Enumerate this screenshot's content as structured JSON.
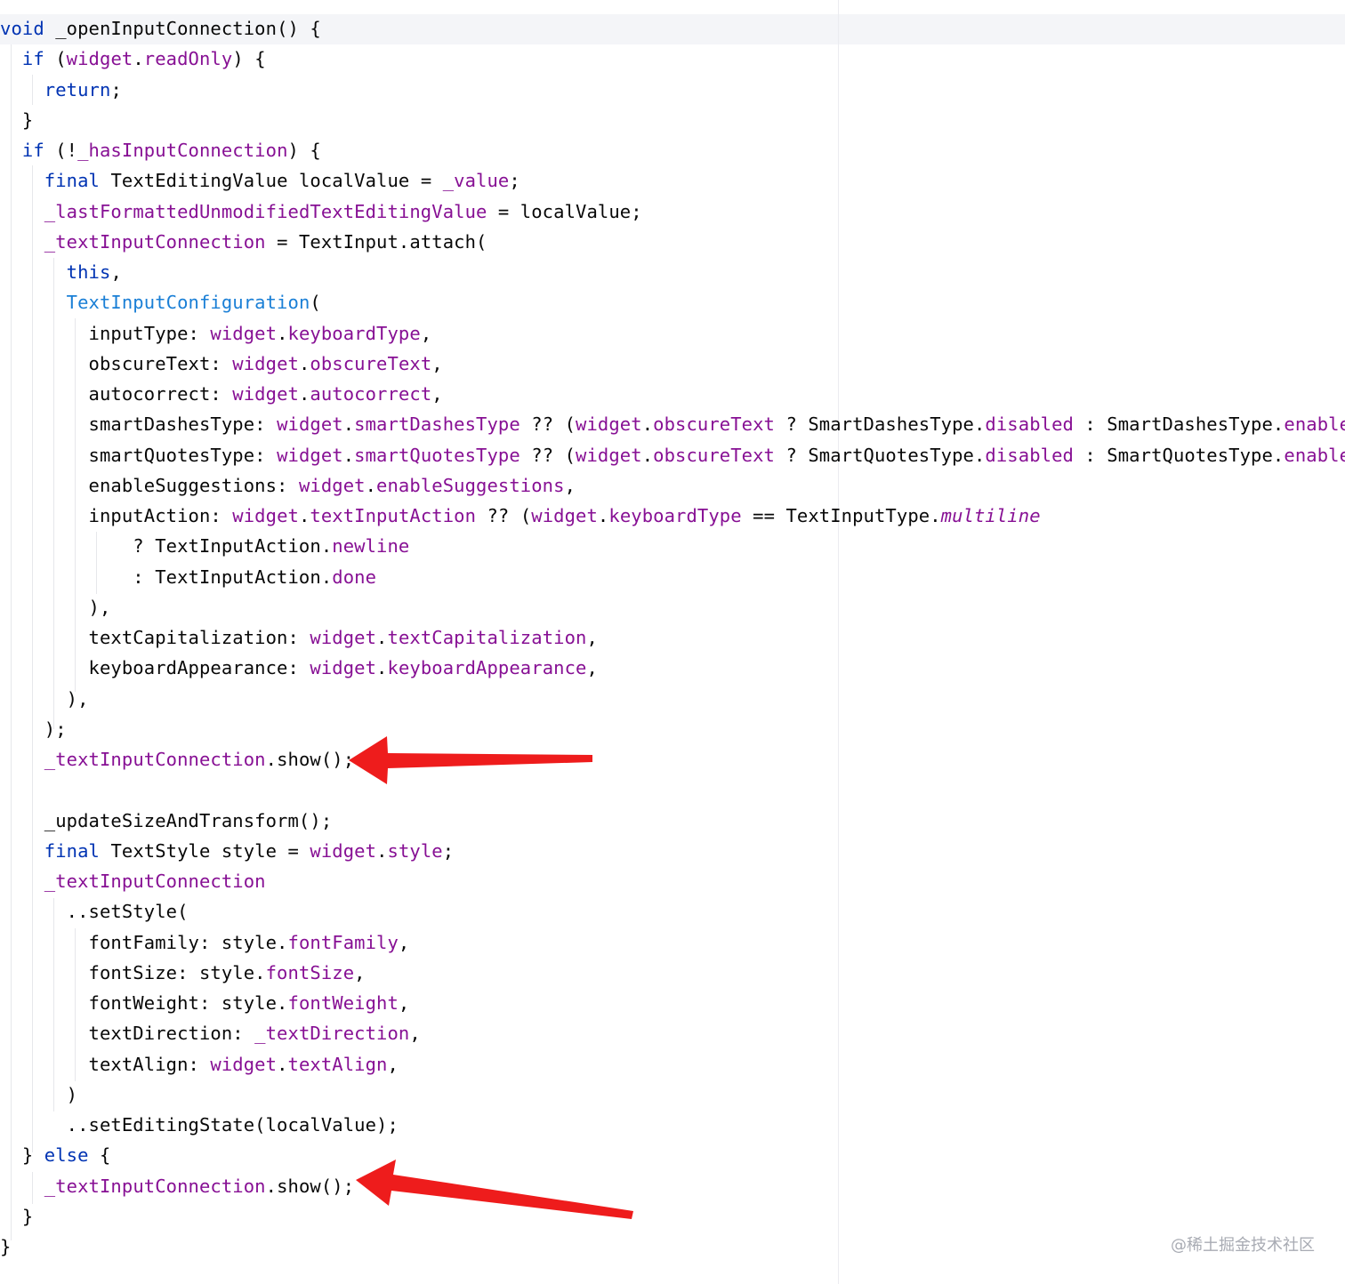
{
  "colors": {
    "keyword": "#0033b3",
    "field": "#871094",
    "function": "#00627a",
    "class": "#1a7fd6",
    "plain": "#080808",
    "arrow": "#ee1c1c",
    "current_line": "#f4f5f8"
  },
  "watermark": "@稀土掘金技术社区",
  "code_lines": [
    [
      {
        "t": "void",
        "c": "kw"
      },
      {
        "t": " _openInputConnection() {"
      }
    ],
    [
      {
        "t": "  "
      },
      {
        "t": "if",
        "c": "kw"
      },
      {
        "t": " ("
      },
      {
        "t": "widget",
        "c": "field"
      },
      {
        "t": "."
      },
      {
        "t": "readOnly",
        "c": "field"
      },
      {
        "t": ") {"
      }
    ],
    [
      {
        "t": "    "
      },
      {
        "t": "return",
        "c": "kw"
      },
      {
        "t": ";"
      }
    ],
    [
      {
        "t": "  }"
      }
    ],
    [
      {
        "t": "  "
      },
      {
        "t": "if",
        "c": "kw"
      },
      {
        "t": " (!"
      },
      {
        "t": "_hasInputConnection",
        "c": "field"
      },
      {
        "t": ") {"
      }
    ],
    [
      {
        "t": "    "
      },
      {
        "t": "final",
        "c": "kw"
      },
      {
        "t": " TextEditingValue localValue = "
      },
      {
        "t": "_value",
        "c": "field"
      },
      {
        "t": ";"
      }
    ],
    [
      {
        "t": "    "
      },
      {
        "t": "_lastFormattedUnmodifiedTextEditingValue",
        "c": "field"
      },
      {
        "t": " = localValue;"
      }
    ],
    [
      {
        "t": "    "
      },
      {
        "t": "_textInputConnection",
        "c": "field"
      },
      {
        "t": " = TextInput.attach("
      }
    ],
    [
      {
        "t": "      "
      },
      {
        "t": "this",
        "c": "kw"
      },
      {
        "t": ","
      }
    ],
    [
      {
        "t": "      "
      },
      {
        "t": "TextInputConfiguration",
        "c": "cls"
      },
      {
        "t": "("
      }
    ],
    [
      {
        "t": "        inputType: "
      },
      {
        "t": "widget",
        "c": "field"
      },
      {
        "t": "."
      },
      {
        "t": "keyboardType",
        "c": "field"
      },
      {
        "t": ","
      }
    ],
    [
      {
        "t": "        obscureText: "
      },
      {
        "t": "widget",
        "c": "field"
      },
      {
        "t": "."
      },
      {
        "t": "obscureText",
        "c": "field"
      },
      {
        "t": ","
      }
    ],
    [
      {
        "t": "        autocorrect: "
      },
      {
        "t": "widget",
        "c": "field"
      },
      {
        "t": "."
      },
      {
        "t": "autocorrect",
        "c": "field"
      },
      {
        "t": ","
      }
    ],
    [
      {
        "t": "        smartDashesType: "
      },
      {
        "t": "widget",
        "c": "field"
      },
      {
        "t": "."
      },
      {
        "t": "smartDashesType",
        "c": "field"
      },
      {
        "t": " ?? ("
      },
      {
        "t": "widget",
        "c": "field"
      },
      {
        "t": "."
      },
      {
        "t": "obscureText",
        "c": "field"
      },
      {
        "t": " ? SmartDashesType."
      },
      {
        "t": "disabled",
        "c": "field"
      },
      {
        "t": " : SmartDashesType."
      },
      {
        "t": "enabled",
        "c": "field"
      },
      {
        "t": "),"
      }
    ],
    [
      {
        "t": "        smartQuotesType: "
      },
      {
        "t": "widget",
        "c": "field"
      },
      {
        "t": "."
      },
      {
        "t": "smartQuotesType",
        "c": "field"
      },
      {
        "t": " ?? ("
      },
      {
        "t": "widget",
        "c": "field"
      },
      {
        "t": "."
      },
      {
        "t": "obscureText",
        "c": "field"
      },
      {
        "t": " ? SmartQuotesType."
      },
      {
        "t": "disabled",
        "c": "field"
      },
      {
        "t": " : SmartQuotesType."
      },
      {
        "t": "enabled",
        "c": "field"
      },
      {
        "t": "),"
      }
    ],
    [
      {
        "t": "        enableSuggestions: "
      },
      {
        "t": "widget",
        "c": "field"
      },
      {
        "t": "."
      },
      {
        "t": "enableSuggestions",
        "c": "field"
      },
      {
        "t": ","
      }
    ],
    [
      {
        "t": "        inputAction: "
      },
      {
        "t": "widget",
        "c": "field"
      },
      {
        "t": "."
      },
      {
        "t": "textInputAction",
        "c": "field"
      },
      {
        "t": " ?? ("
      },
      {
        "t": "widget",
        "c": "field"
      },
      {
        "t": "."
      },
      {
        "t": "keyboardType",
        "c": "field"
      },
      {
        "t": " == TextInputType."
      },
      {
        "t": "multiline",
        "c": "field-it"
      }
    ],
    [
      {
        "t": "            ? TextInputAction."
      },
      {
        "t": "newline",
        "c": "field"
      }
    ],
    [
      {
        "t": "            : TextInputAction."
      },
      {
        "t": "done",
        "c": "field"
      }
    ],
    [
      {
        "t": "        ),"
      }
    ],
    [
      {
        "t": "        textCapitalization: "
      },
      {
        "t": "widget",
        "c": "field"
      },
      {
        "t": "."
      },
      {
        "t": "textCapitalization",
        "c": "field"
      },
      {
        "t": ","
      }
    ],
    [
      {
        "t": "        keyboardAppearance: "
      },
      {
        "t": "widget",
        "c": "field"
      },
      {
        "t": "."
      },
      {
        "t": "keyboardAppearance",
        "c": "field"
      },
      {
        "t": ","
      }
    ],
    [
      {
        "t": "      ),"
      }
    ],
    [
      {
        "t": "    );"
      }
    ],
    [
      {
        "t": "    "
      },
      {
        "t": "_textInputConnection",
        "c": "field"
      },
      {
        "t": ".show();"
      }
    ],
    [
      {
        "t": ""
      }
    ],
    [
      {
        "t": "    _updateSizeAndTransform();"
      }
    ],
    [
      {
        "t": "    "
      },
      {
        "t": "final",
        "c": "kw"
      },
      {
        "t": " TextStyle style = "
      },
      {
        "t": "widget",
        "c": "field"
      },
      {
        "t": "."
      },
      {
        "t": "style",
        "c": "field"
      },
      {
        "t": ";"
      }
    ],
    [
      {
        "t": "    "
      },
      {
        "t": "_textInputConnection",
        "c": "field"
      }
    ],
    [
      {
        "t": "      ..setStyle("
      }
    ],
    [
      {
        "t": "        fontFamily: style."
      },
      {
        "t": "fontFamily",
        "c": "field"
      },
      {
        "t": ","
      }
    ],
    [
      {
        "t": "        fontSize: style."
      },
      {
        "t": "fontSize",
        "c": "field"
      },
      {
        "t": ","
      }
    ],
    [
      {
        "t": "        fontWeight: style."
      },
      {
        "t": "fontWeight",
        "c": "field"
      },
      {
        "t": ","
      }
    ],
    [
      {
        "t": "        textDirection: "
      },
      {
        "t": "_textDirection",
        "c": "field"
      },
      {
        "t": ","
      }
    ],
    [
      {
        "t": "        textAlign: "
      },
      {
        "t": "widget",
        "c": "field"
      },
      {
        "t": "."
      },
      {
        "t": "textAlign",
        "c": "field"
      },
      {
        "t": ","
      }
    ],
    [
      {
        "t": "      )"
      }
    ],
    [
      {
        "t": "      ..setEditingState(localValue);"
      }
    ],
    [
      {
        "t": "  } "
      },
      {
        "t": "else",
        "c": "kw"
      },
      {
        "t": " {"
      }
    ],
    [
      {
        "t": "    "
      },
      {
        "t": "_textInputConnection",
        "c": "field"
      },
      {
        "t": ".show();"
      }
    ],
    [
      {
        "t": "  }"
      }
    ],
    [
      {
        "t": "}"
      }
    ]
  ]
}
